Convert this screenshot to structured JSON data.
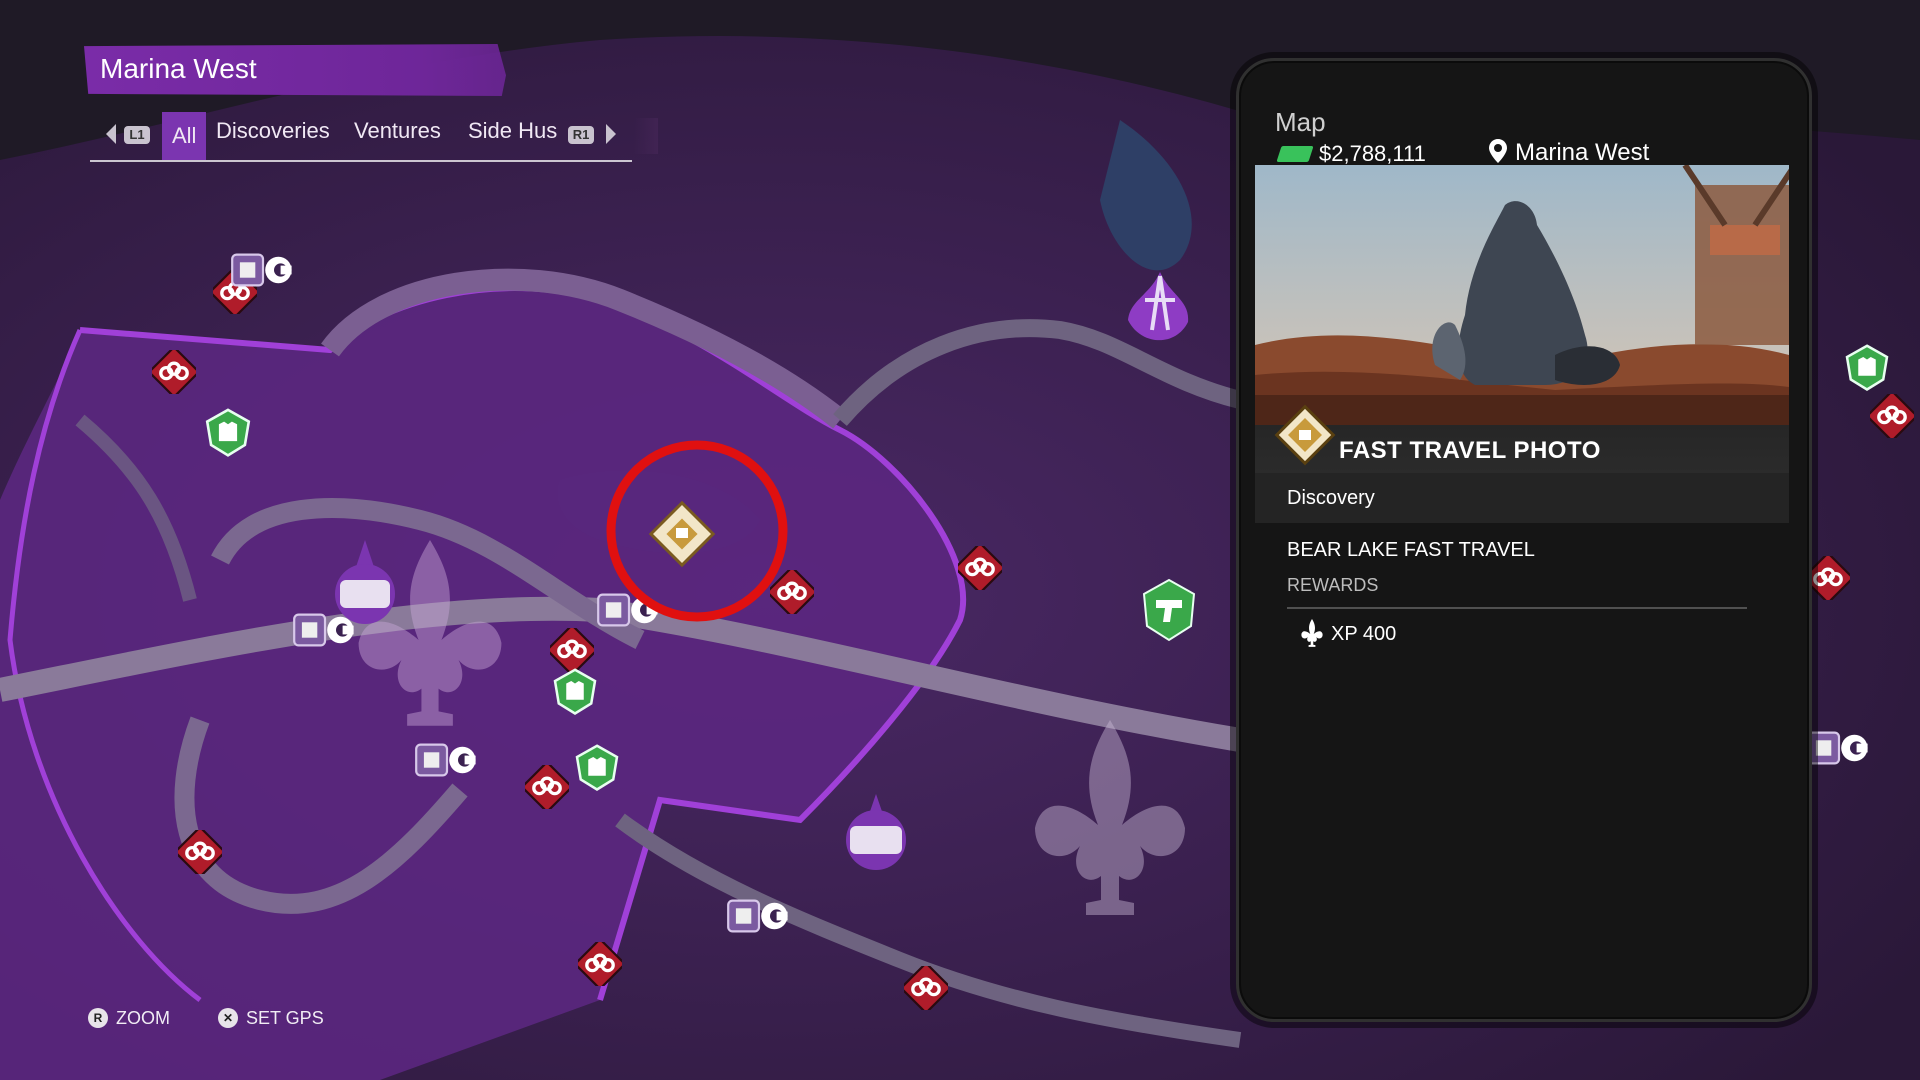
{
  "area_banner": {
    "title": "Marina West"
  },
  "filter_bar": {
    "left_button": "L1",
    "right_button": "R1",
    "tabs": [
      {
        "label": "All",
        "active": true
      },
      {
        "label": "Discoveries",
        "active": false
      },
      {
        "label": "Ventures",
        "active": false
      },
      {
        "label": "Side Hus",
        "active": false
      }
    ]
  },
  "bottom_hints": [
    {
      "button": "R",
      "label": "ZOOM"
    },
    {
      "button": "✕",
      "label": "SET GPS"
    }
  ],
  "phone": {
    "header": "Map",
    "cash": "$2,788,111",
    "location": "Marina West",
    "card": {
      "title": "FAST TRAVEL PHOTO",
      "category": "Discovery",
      "mission": "BEAR LAKE FAST TRAVEL",
      "rewards_label": "REWARDS",
      "rewards": [
        {
          "label": "XP 400"
        }
      ]
    }
  },
  "map_markers": [
    {
      "type": "fast-travel",
      "selected": true
    },
    {
      "type": "brass-knuckles"
    },
    {
      "type": "clothing-store"
    },
    {
      "type": "gun-store"
    },
    {
      "type": "saints-hq"
    }
  ],
  "colors": {
    "map_background": "#3a2150",
    "district_highlight": "#6c2a8f",
    "roads": "#6f5a80",
    "banner_purple": "#7a2ca8",
    "selection_ring": "#e01010",
    "clothing_green": "#3aa84a"
  }
}
